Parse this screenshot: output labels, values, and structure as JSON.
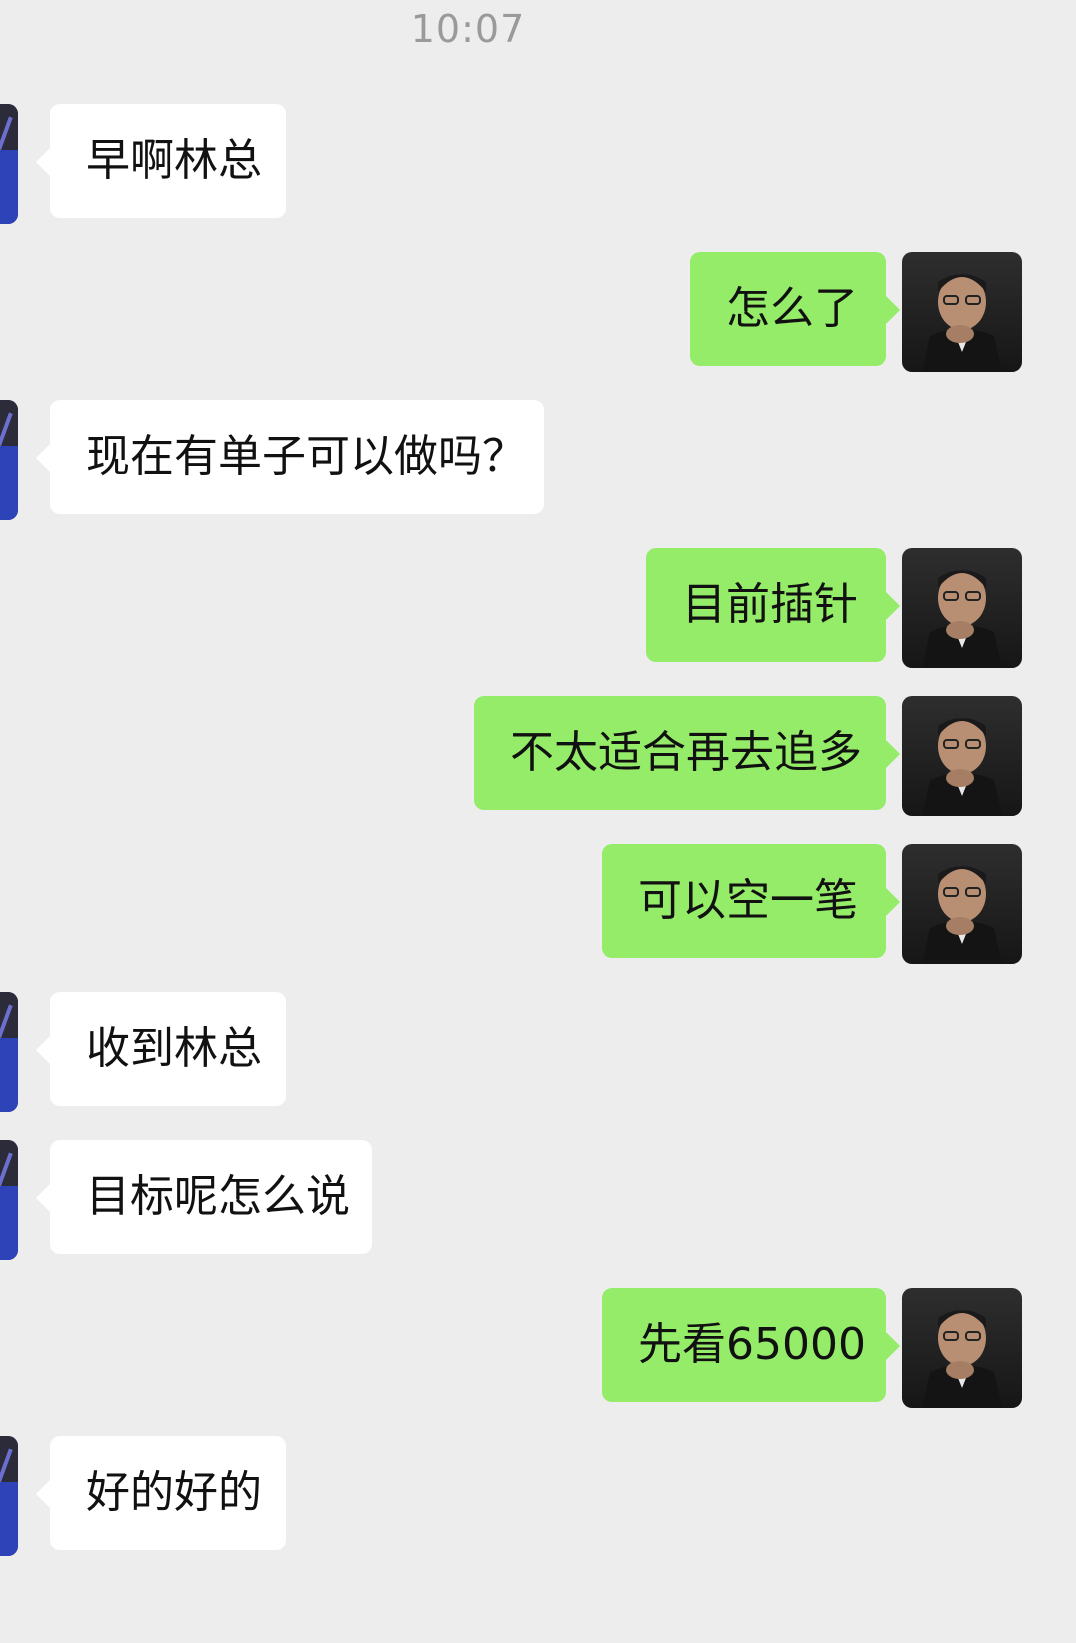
{
  "status": {
    "time": "10:07"
  },
  "messages": [
    {
      "side": "in",
      "text": "早啊林总"
    },
    {
      "side": "out",
      "text": "怎么了"
    },
    {
      "side": "in",
      "text": "现在有单子可以做吗？"
    },
    {
      "side": "out",
      "text": "目前插针"
    },
    {
      "side": "out",
      "text": "不太适合再去追多"
    },
    {
      "side": "out",
      "text": "可以空一笔"
    },
    {
      "side": "in",
      "text": "收到林总"
    },
    {
      "side": "in",
      "text": "目标呢怎么说"
    },
    {
      "side": "out",
      "text": "先看65000"
    },
    {
      "side": "in",
      "text": "好的好的"
    }
  ],
  "colors": {
    "background": "#ededed",
    "incoming_bubble": "#ffffff",
    "outgoing_bubble": "#95ec69",
    "timestamp": "#9a9a9a"
  },
  "icons": {
    "incoming_avatar": "contact-avatar-icon",
    "outgoing_avatar": "self-avatar-photo"
  }
}
